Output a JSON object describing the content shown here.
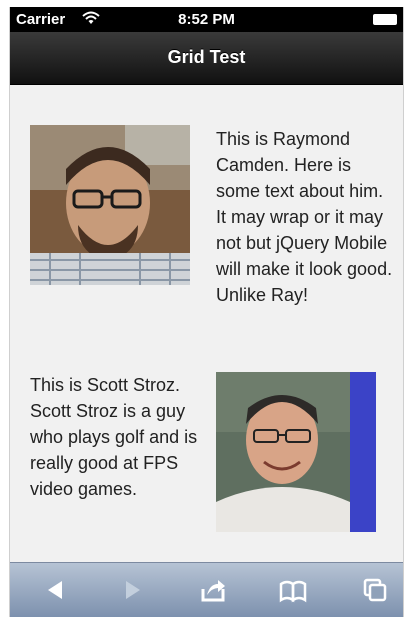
{
  "status_bar": {
    "carrier": "Carrier",
    "time": "8:52 PM"
  },
  "header": {
    "title": "Grid Test"
  },
  "main": {
    "items": [
      {
        "name": "raymond",
        "text": "This is Raymond Camden. Here is some text about him. It may wrap or it may not but jQuery Mobile will make it look good. Unlike Ray!"
      },
      {
        "name": "scott",
        "text": "This is Scott Stroz. Scott Stroz is a guy who plays golf and is really good at FPS video games."
      }
    ]
  },
  "toolbar": {
    "buttons": [
      {
        "icon": "back-arrow-icon",
        "enabled": true
      },
      {
        "icon": "forward-arrow-icon",
        "enabled": false
      },
      {
        "icon": "share-icon",
        "enabled": true
      },
      {
        "icon": "bookmarks-icon",
        "enabled": true
      },
      {
        "icon": "tabs-icon",
        "enabled": true
      }
    ]
  },
  "colors": {
    "status_bar": "#000000",
    "nav_bar": "#1c1c1c",
    "content_background": "#f1f1f1",
    "toolbar": "#9fb0c6",
    "accent_photo_band": "#3b43c7"
  }
}
